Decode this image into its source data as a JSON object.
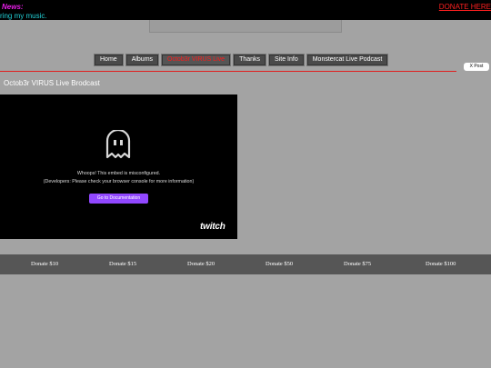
{
  "topbar": {
    "news_label": "News:",
    "ticker_text": "ring my music.",
    "donate_link": "DONATE HERE"
  },
  "nav": {
    "items": [
      {
        "label": "Home"
      },
      {
        "label": "Albums"
      },
      {
        "label": "Octob3r VIRUS Live"
      },
      {
        "label": "Thanks"
      },
      {
        "label": "Site Info"
      },
      {
        "label": "Monstercat Live Podcast"
      }
    ],
    "active_index": 2
  },
  "x_post_label": "X Post",
  "broadcast": {
    "title": "Octob3r VIRUS Live Brodcast",
    "embed_message": "Whoops! This embed is misconfigured.",
    "embed_details": "(Developers: Please check your browser console for more information)",
    "doc_button": "Go to Documentation",
    "logo_text": "twitch"
  },
  "donations": [
    "Donate $10",
    "Donate $15",
    "Donate $20",
    "Donate $50",
    "Donate $75",
    "Donate $100"
  ],
  "colors": {
    "accent_red": "#ff1a1a",
    "news_magenta": "#e61ee6",
    "ticker_cyan": "#22d0d6",
    "twitch_purple": "#9147ff"
  }
}
